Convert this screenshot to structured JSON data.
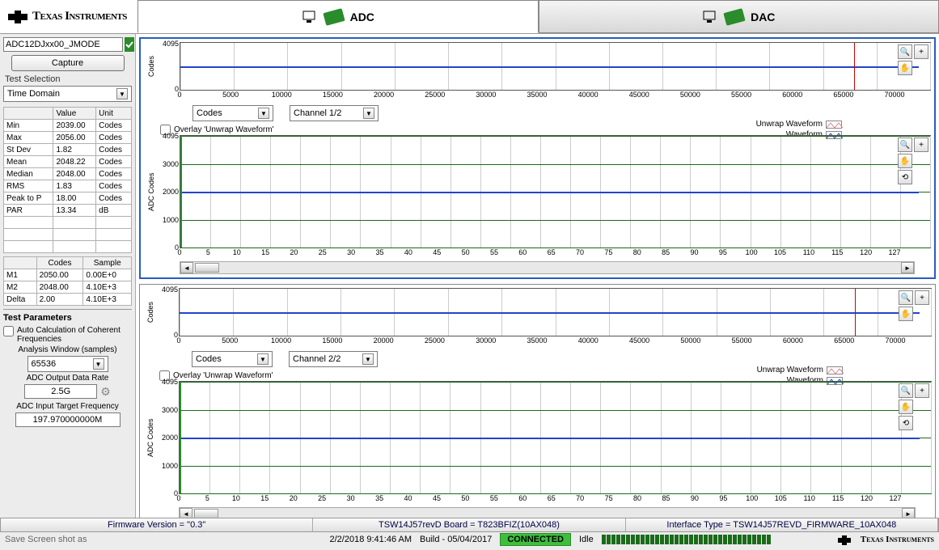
{
  "header": {
    "brand": "Texas Instruments",
    "tabs": [
      "ADC",
      "DAC"
    ],
    "active_tab": 0
  },
  "sidebar": {
    "device": "ADC12DJxx00_JMODE",
    "capture_label": "Capture",
    "test_selection_label": "Test Selection",
    "test_selection_value": "Time Domain",
    "stats_headers": [
      "",
      "Value",
      "Unit"
    ],
    "stats": [
      {
        "name": "Min",
        "value": "2039.00",
        "unit": "Codes"
      },
      {
        "name": "Max",
        "value": "2056.00",
        "unit": "Codes"
      },
      {
        "name": "St Dev",
        "value": "1.82",
        "unit": "Codes"
      },
      {
        "name": "Mean",
        "value": "2048.22",
        "unit": "Codes"
      },
      {
        "name": "Median",
        "value": "2048.00",
        "unit": "Codes"
      },
      {
        "name": "RMS",
        "value": "1.83",
        "unit": "Codes"
      },
      {
        "name": "Peak to P",
        "value": "18.00",
        "unit": "Codes"
      },
      {
        "name": "PAR",
        "value": "13.34",
        "unit": "dB"
      }
    ],
    "markers_headers": [
      "",
      "Codes",
      "Sample"
    ],
    "markers": [
      {
        "name": "M1",
        "codes": "2050.00",
        "sample": "0.00E+0"
      },
      {
        "name": "M2",
        "codes": "2048.00",
        "sample": "4.10E+3",
        "cls": "row-m2"
      },
      {
        "name": "Delta",
        "codes": "2.00",
        "sample": "4.10E+3",
        "cls": "row-delta"
      }
    ],
    "test_params_header": "Test Parameters",
    "auto_calc_label": "Auto Calculation of Coherent Frequencies",
    "analysis_window_label": "Analysis Window (samples)",
    "analysis_window_value": "65536",
    "output_rate_label": "ADC Output Data Rate",
    "output_rate_value": "2.5G",
    "input_freq_label": "ADC Input Target Frequency",
    "input_freq_value": "197.970000000M"
  },
  "plots": {
    "mini_ylabel": "Codes",
    "mini_yticks": [
      "4095",
      "0"
    ],
    "mini_xticks": [
      "0",
      "5000",
      "10000",
      "15000",
      "20000",
      "25000",
      "30000",
      "35000",
      "40000",
      "45000",
      "50000",
      "55000",
      "60000",
      "65000",
      "70000"
    ],
    "codes_dd": "Codes",
    "channel1_dd": "Channel 1/2",
    "channel2_dd": "Channel 2/2",
    "overlay_label": "Overlay 'Unwrap Waveform'",
    "large_ylabel": "ADC Codes",
    "large_yticks": [
      "4095",
      "3000",
      "2000",
      "1000",
      "0"
    ],
    "large_xticks": [
      "0",
      "5",
      "10",
      "15",
      "20",
      "25",
      "30",
      "35",
      "40",
      "45",
      "50",
      "55",
      "60",
      "65",
      "70",
      "75",
      "80",
      "85",
      "90",
      "95",
      "100",
      "105",
      "110",
      "115",
      "120",
      "127"
    ],
    "legend_unwrap": "Unwrap Waveform",
    "legend_waveform": "Waveform"
  },
  "status": {
    "firmware": "Firmware Version = \"0.3\"",
    "board": "TSW14J57revD Board = T823BFIZ(10AX048)",
    "interface": "Interface Type = TSW14J57REVD_FIRMWARE_10AX048"
  },
  "bottom": {
    "save_shot": "Save Screen shot as",
    "timestamp": "2/2/2018 9:41:46 AM",
    "build": "Build - 05/04/2017",
    "connected": "CONNECTED",
    "idle": "Idle",
    "brand": "Texas Instruments"
  },
  "chart_data": [
    {
      "type": "line",
      "title": "Channel 1/2 mini",
      "ylabel": "Codes",
      "ylim": [
        0,
        4095
      ],
      "xlim": [
        0,
        70000
      ],
      "series": [
        {
          "name": "Waveform",
          "approx_constant": 2048
        }
      ]
    },
    {
      "type": "line",
      "title": "Channel 1/2 large",
      "ylabel": "ADC Codes",
      "ylim": [
        0,
        4095
      ],
      "xlim": [
        0,
        127
      ],
      "series": [
        {
          "name": "Waveform",
          "approx_constant": 2048
        },
        {
          "name": "Unwrap Waveform",
          "approx_constant": 4095
        }
      ]
    },
    {
      "type": "line",
      "title": "Channel 2/2 mini",
      "ylabel": "Codes",
      "ylim": [
        0,
        4095
      ],
      "xlim": [
        0,
        70000
      ],
      "series": [
        {
          "name": "Waveform",
          "approx_constant": 2048
        }
      ]
    },
    {
      "type": "line",
      "title": "Channel 2/2 large",
      "ylabel": "ADC Codes",
      "ylim": [
        0,
        4095
      ],
      "xlim": [
        0,
        127
      ],
      "series": [
        {
          "name": "Waveform",
          "approx_constant": 2048
        },
        {
          "name": "Unwrap Waveform",
          "approx_constant": 4095
        }
      ]
    }
  ]
}
